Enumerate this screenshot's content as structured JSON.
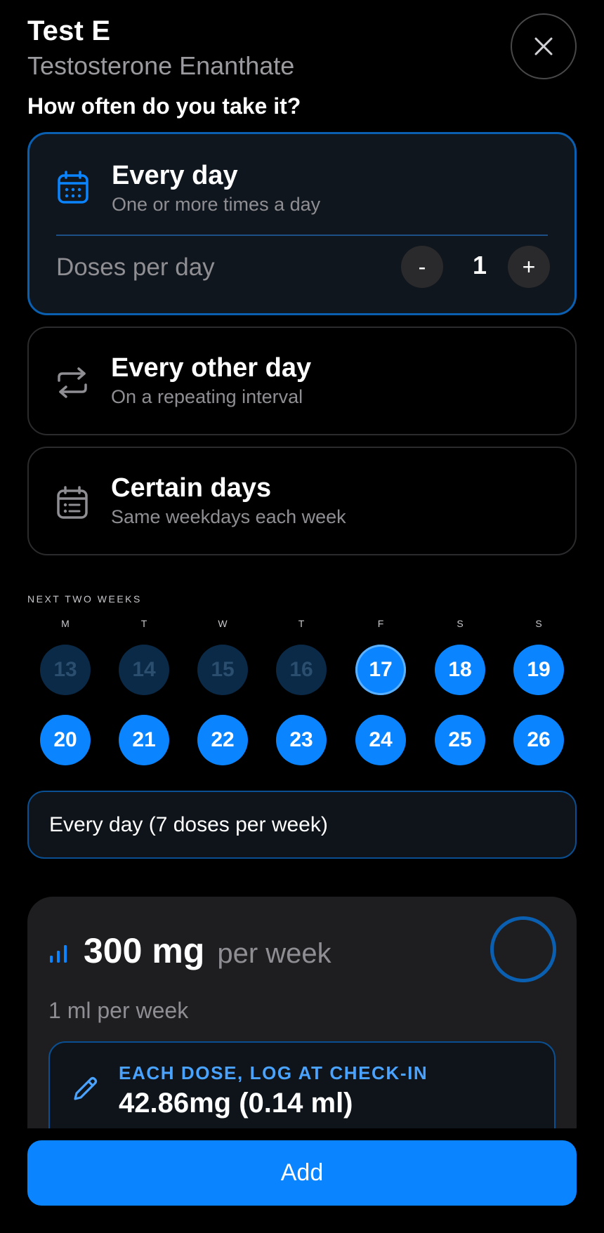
{
  "header": {
    "title": "Test E",
    "subtitle": "Testosterone Enanthate",
    "question": "How often do you take it?"
  },
  "frequency_options": [
    {
      "title": "Every day",
      "subtitle": "One or more times a day",
      "icon": "calendar-icon",
      "selected": true
    },
    {
      "title": "Every other day",
      "subtitle": "On a repeating interval",
      "icon": "repeat-icon",
      "selected": false
    },
    {
      "title": "Certain days",
      "subtitle": "Same weekdays each week",
      "icon": "calendar-list-icon",
      "selected": false
    }
  ],
  "doses": {
    "label": "Doses per day",
    "minus": "-",
    "value": "1",
    "plus": "+"
  },
  "calendar": {
    "label": "NEXT TWO WEEKS",
    "weekdays": [
      "M",
      "T",
      "W",
      "T",
      "F",
      "S",
      "S"
    ],
    "week1": [
      "13",
      "14",
      "15",
      "16",
      "17",
      "18",
      "19"
    ],
    "week2": [
      "20",
      "21",
      "22",
      "23",
      "24",
      "25",
      "26"
    ],
    "past_days": [
      "13",
      "14",
      "15",
      "16"
    ],
    "today": "17"
  },
  "summary": "Every day (7 doses per week)",
  "dose_panel": {
    "amount": "300 mg",
    "unit": "per week",
    "ml": "1 ml per week",
    "each_label": "EACH DOSE, LOG AT CHECK-IN",
    "each_value": "42.86mg (0.14 ml)"
  },
  "add_label": "Add",
  "colors": {
    "accent": "#0a84ff",
    "background": "#000000",
    "selected_border": "#0a5fb0"
  }
}
